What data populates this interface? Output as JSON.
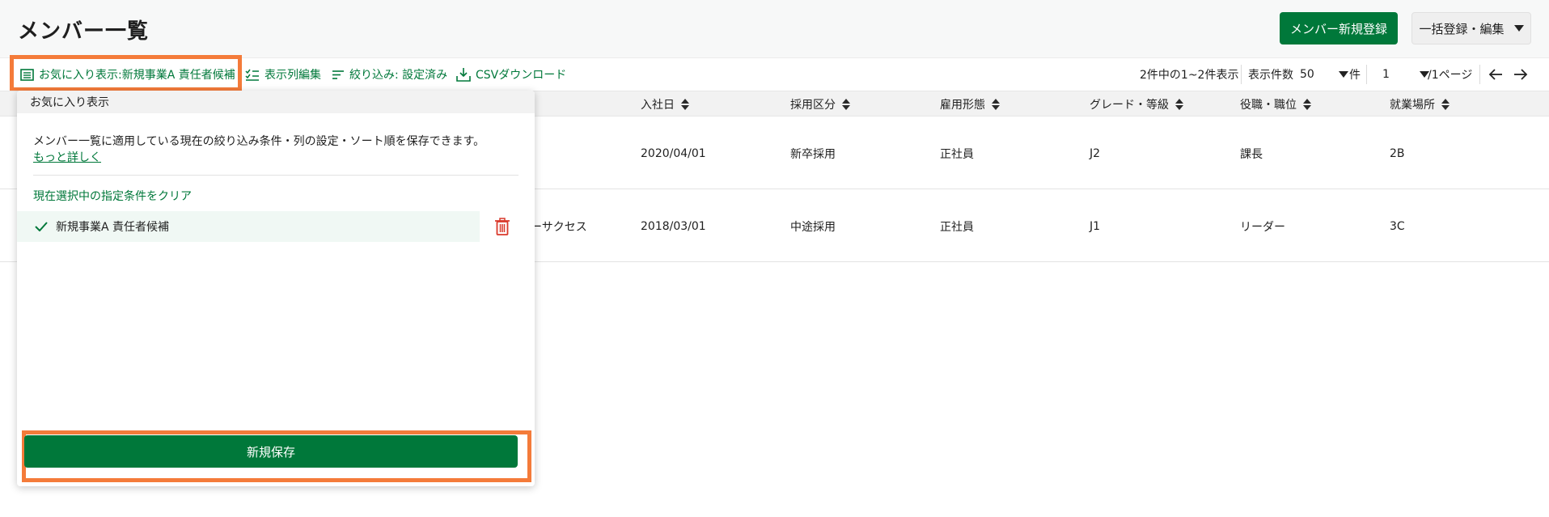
{
  "header": {
    "title": "メンバー一覧",
    "new_member_button": "メンバー新規登録",
    "bulk_button": "一括登録・編集"
  },
  "toolbar": {
    "favorites_label": "お気に入り表示:新規事業A 責任者候補",
    "columns_label": "表示列編集",
    "filter_label": "絞り込み: 設定済み",
    "csv_label": "CSVダウンロード",
    "result_count": "2件中の1~2件表示",
    "per_page_label": "表示件数",
    "per_page_value": "50",
    "per_page_unit": "件",
    "page_value": "1",
    "page_total": "/1ページ",
    "prev_icon": "arrow-left-icon",
    "next_icon": "arrow-right-icon"
  },
  "table": {
    "columns": [
      "入社日",
      "採用区分",
      "雇用形態",
      "グレード・等級",
      "役職・職位",
      "就業場所"
    ],
    "rows": [
      {
        "partial": "",
        "hire_date": "2020/04/01",
        "recruit_type": "新卒採用",
        "employment": "正社員",
        "grade": "J2",
        "position": "課長",
        "location": "2B"
      },
      {
        "partial": "ーサクセス",
        "hire_date": "2018/03/01",
        "recruit_type": "中途採用",
        "employment": "正社員",
        "grade": "J1",
        "position": "リーダー",
        "location": "3C"
      }
    ]
  },
  "panel": {
    "title": "お気に入り表示",
    "description": "メンバー一覧に適用している現在の絞り込み条件・列の設定・ソート順を保存できます。",
    "more_link": "もっと詳しく",
    "clear_link": "現在選択中の指定条件をクリア",
    "favorites": [
      {
        "label": "新規事業A 責任者候補",
        "selected": true
      }
    ],
    "save_button": "新規保存"
  },
  "colors": {
    "brand_green": "#00783a",
    "highlight_orange": "#f47b3a",
    "trash_red": "#d9392b"
  }
}
